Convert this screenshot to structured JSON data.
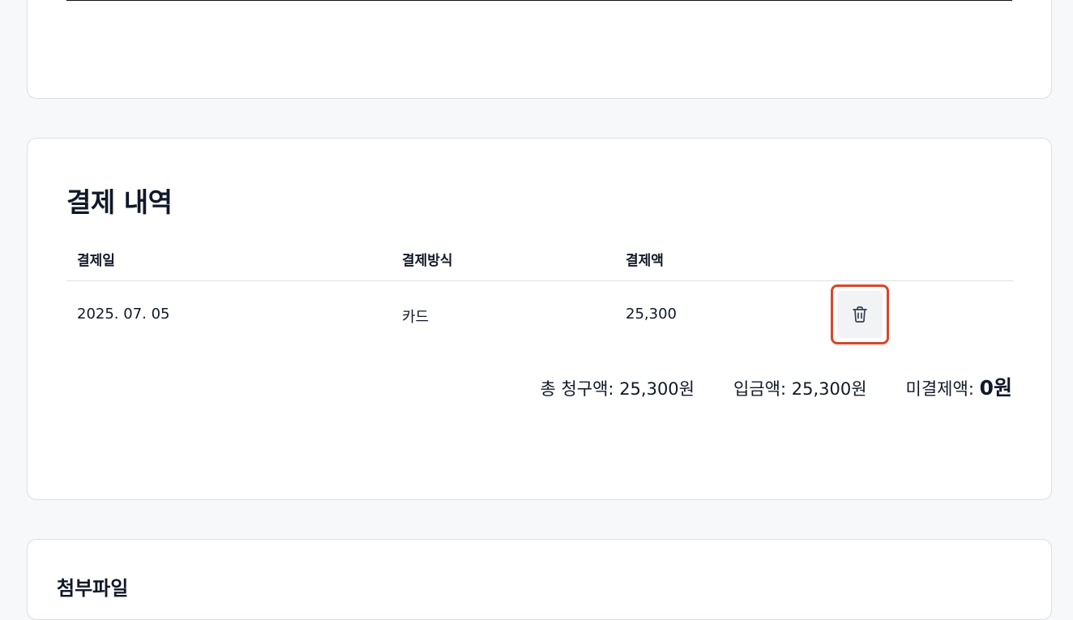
{
  "payment_section": {
    "title": "결제 내역",
    "columns": {
      "date": "결제일",
      "method": "결제방식",
      "amount": "결제액"
    },
    "rows": [
      {
        "date": "2025. 07. 05",
        "method": "카드",
        "amount": "25,300",
        "delete_icon": "trash-icon"
      }
    ],
    "summary": {
      "total_label": "총 청구액:",
      "total_value": "25,300원",
      "paid_label": "입금액:",
      "paid_value": "25,300원",
      "unpaid_label": "미결제액:",
      "unpaid_value": "0원"
    }
  },
  "attachments_section": {
    "title": "첨부파일"
  },
  "colors": {
    "highlight_border": "#d9472b",
    "card_border": "#dcdfe4",
    "background": "#f7f8fa"
  }
}
